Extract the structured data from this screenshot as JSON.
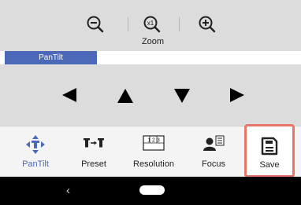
{
  "zoom": {
    "label": "Zoom"
  },
  "pantilt_panel": {
    "tab_label": "PanTilt"
  },
  "toolbar": {
    "items": [
      {
        "label": "PanTilt",
        "icon": "pantilt-icon",
        "active": true
      },
      {
        "label": "Preset",
        "icon": "preset-icon"
      },
      {
        "label": "Resolution",
        "icon": "resolution-icon",
        "icon_text": "1 2 3"
      },
      {
        "label": "Focus",
        "icon": "focus-icon"
      },
      {
        "label": "Save",
        "icon": "save-icon",
        "highlighted": true
      }
    ]
  },
  "navbar": {
    "back_glyph": "‹"
  },
  "colors": {
    "accent": "#4b69b8",
    "highlight": "#e87565",
    "panel": "#dcdcdc"
  }
}
